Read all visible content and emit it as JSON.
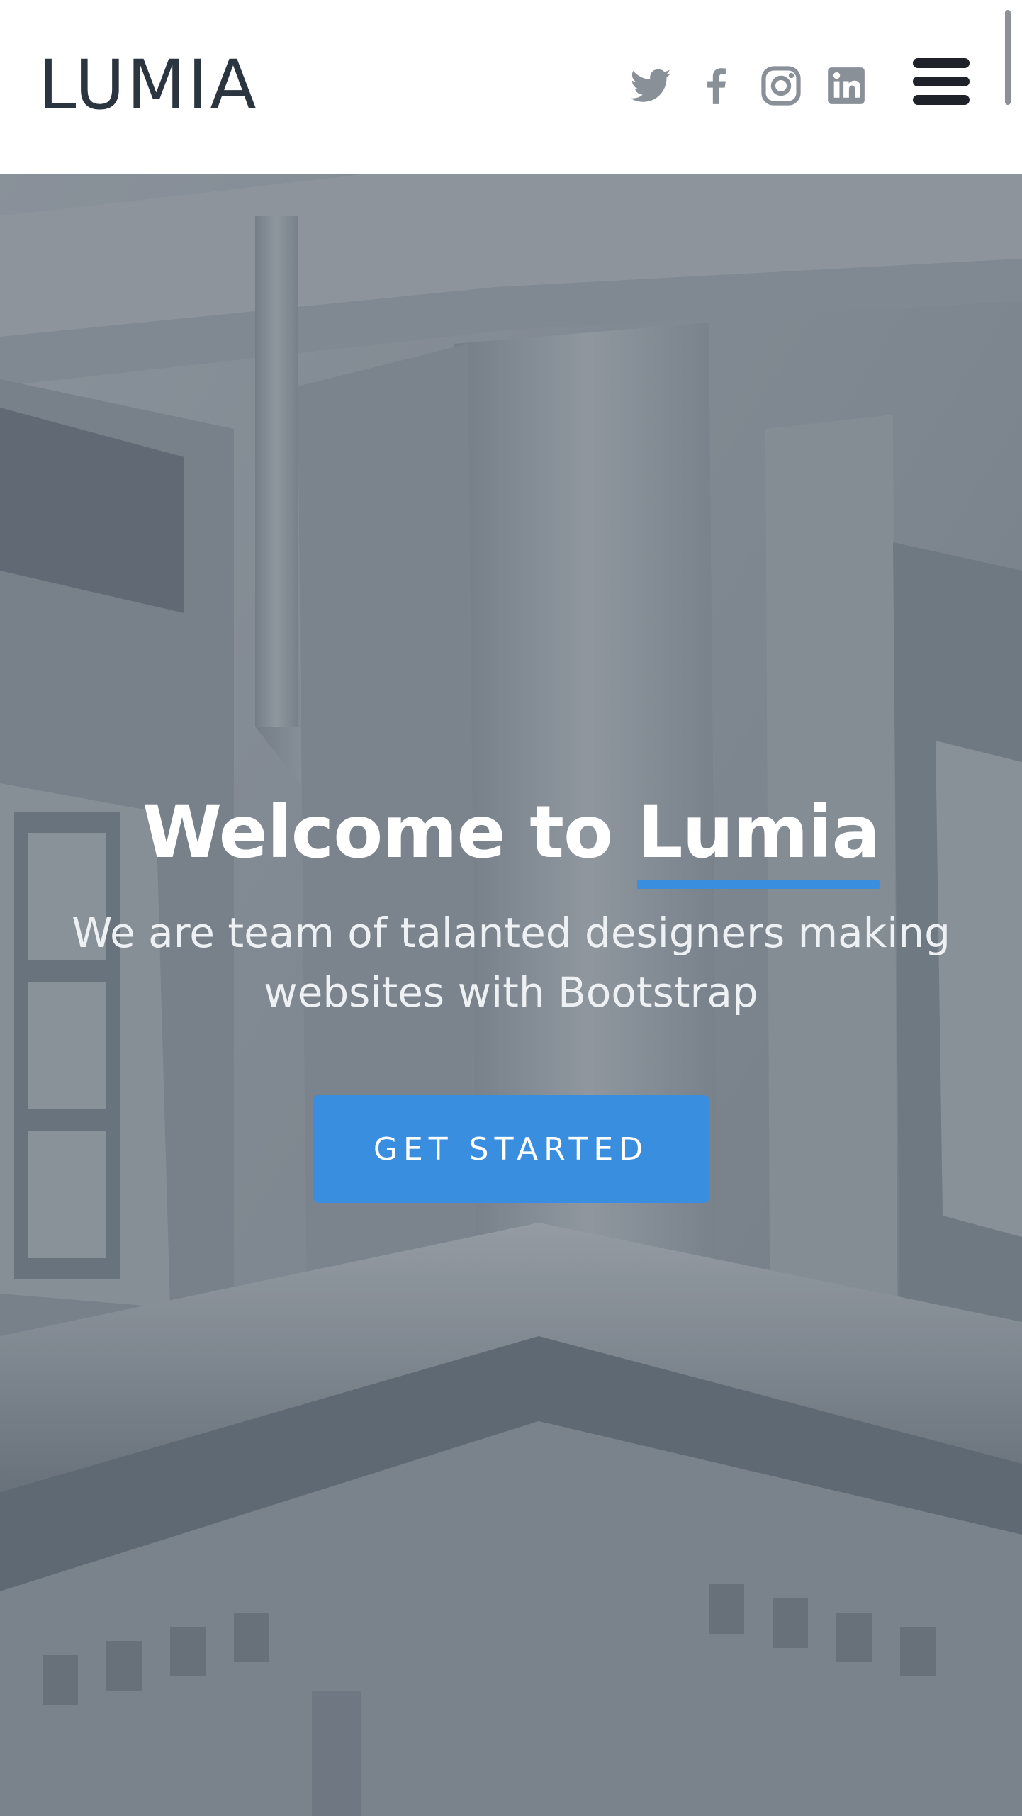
{
  "header": {
    "logo": "LUMIA",
    "social": [
      "twitter-icon",
      "facebook-icon",
      "instagram-icon",
      "linkedin-icon"
    ],
    "menu_icon": "hamburger-menu-icon"
  },
  "hero": {
    "title_prefix": "Welcome to",
    "title_brand": "Lumia",
    "subtitle": "We are team of talanted designers making websites with Bootstrap",
    "cta_label": "GET STARTED"
  },
  "colors": {
    "accent": "#3a8ee0",
    "logo_text": "#2b3540",
    "social_icon": "#8a9097",
    "menu_icon": "#1f2329"
  }
}
